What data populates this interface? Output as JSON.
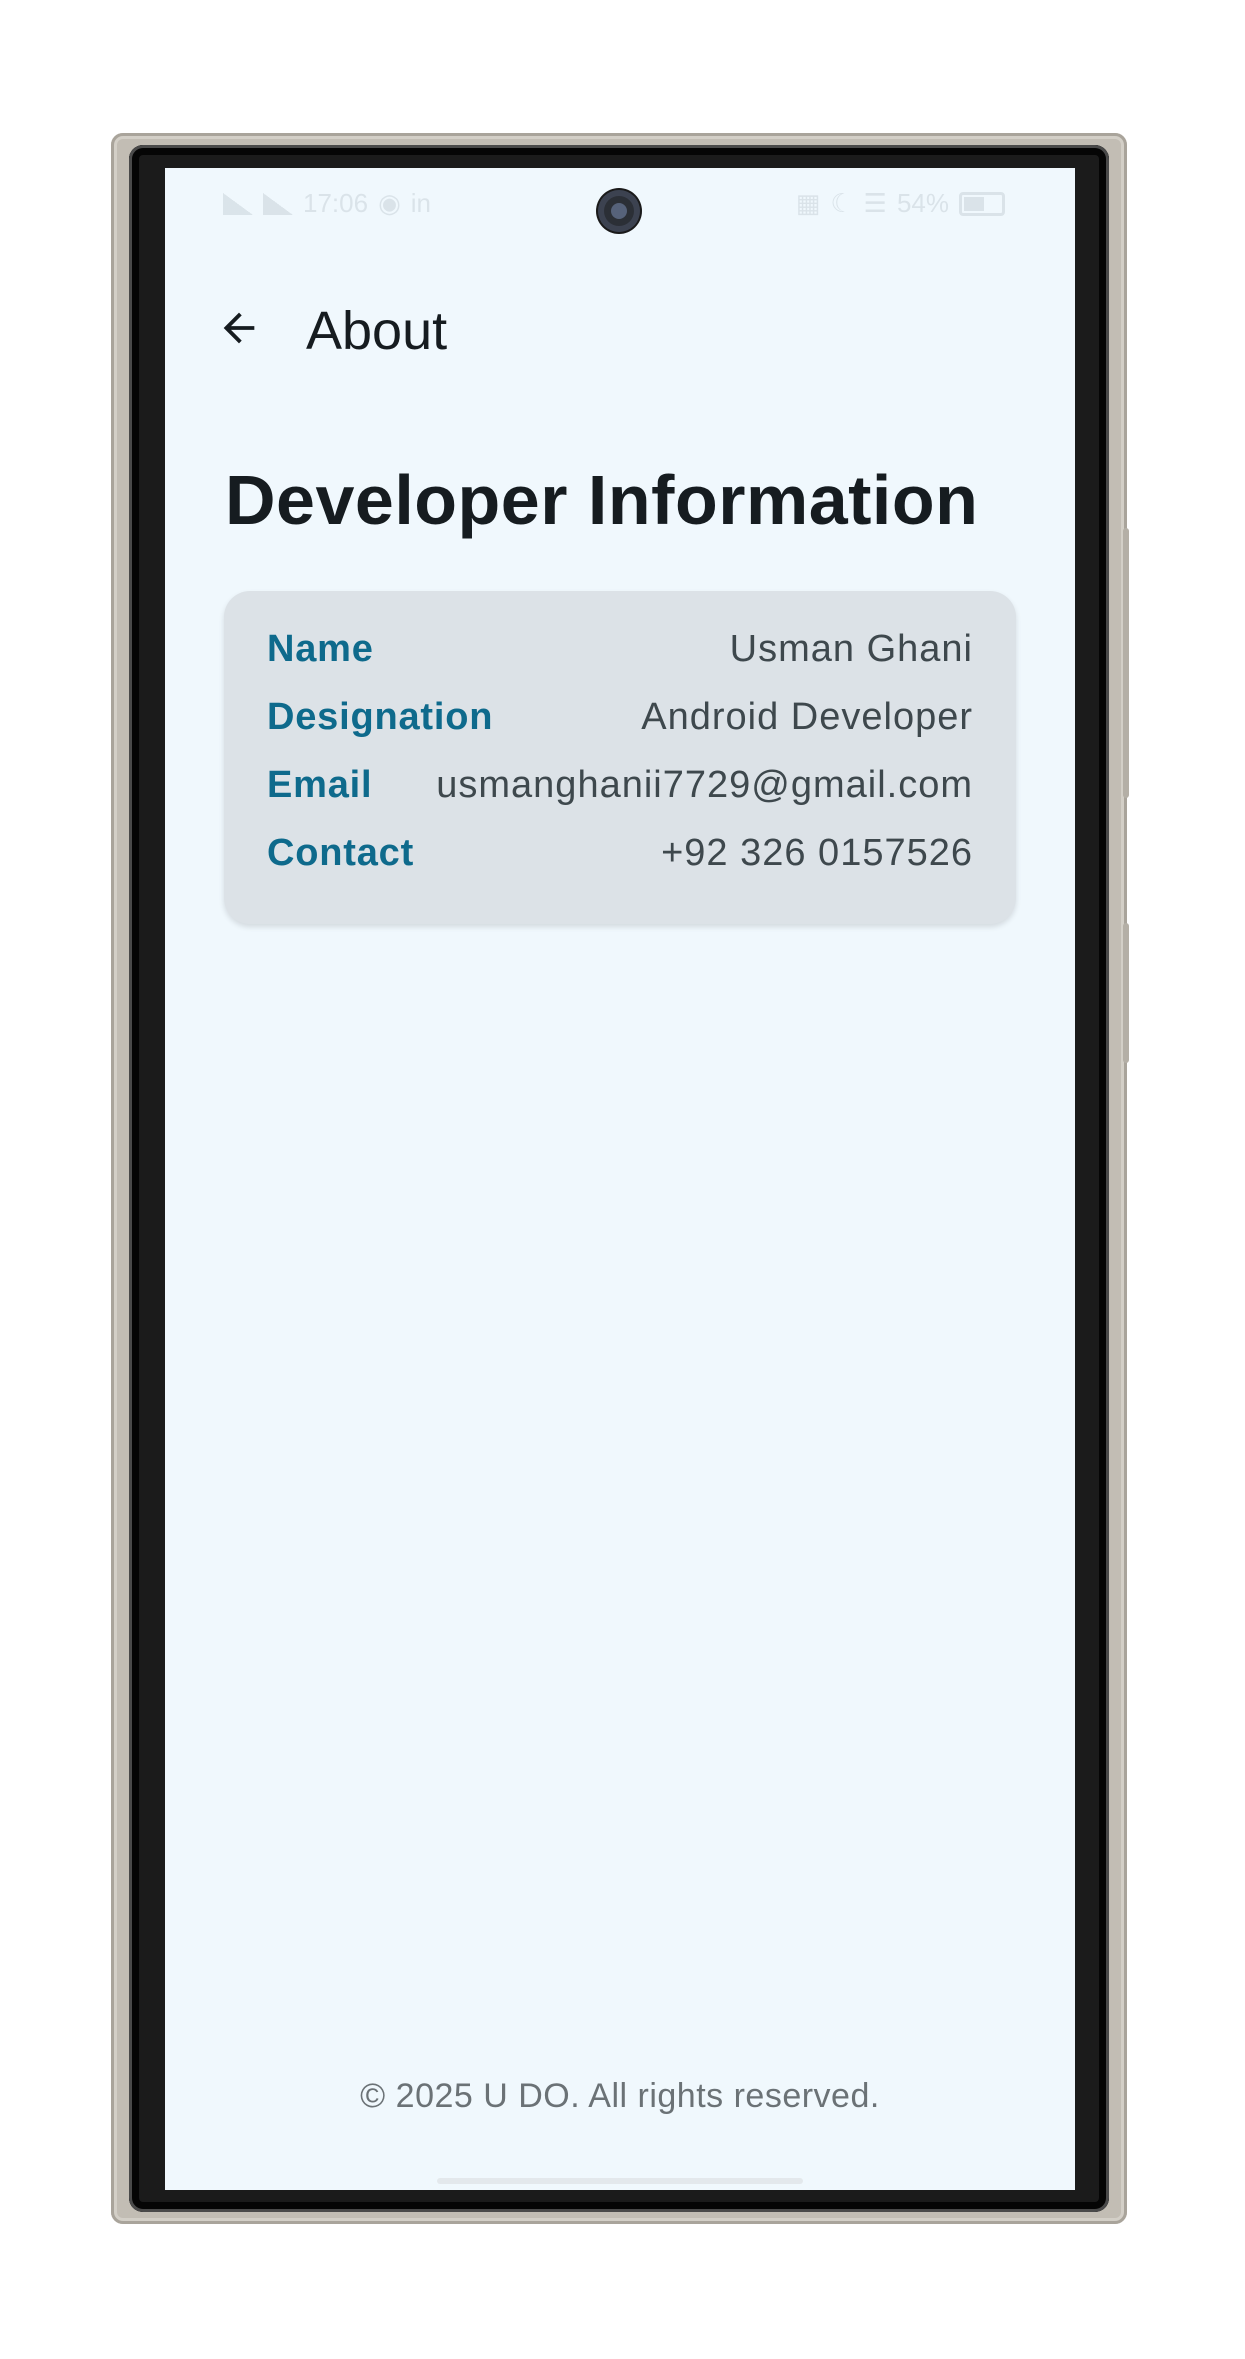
{
  "status_bar": {
    "time": "17:06",
    "battery": "54%"
  },
  "app_bar": {
    "back_icon": "arrow-back-icon",
    "title": "About"
  },
  "section": {
    "title": "Developer Information"
  },
  "developer": {
    "rows": [
      {
        "label": "Name",
        "value": "Usman Ghani"
      },
      {
        "label": "Designation",
        "value": "Android Developer"
      },
      {
        "label": "Email",
        "value": "usmanghanii7729@gmail.com"
      },
      {
        "label": "Contact",
        "value": "+92 326 0157526"
      }
    ]
  },
  "footer": {
    "text": "© 2025 U DO. All rights reserved."
  },
  "colors": {
    "background": "#f0f8fd",
    "card": "#dce2e7",
    "label_accent": "#0e6a8c",
    "value_text": "#3e484d",
    "title_text": "#161c20"
  }
}
